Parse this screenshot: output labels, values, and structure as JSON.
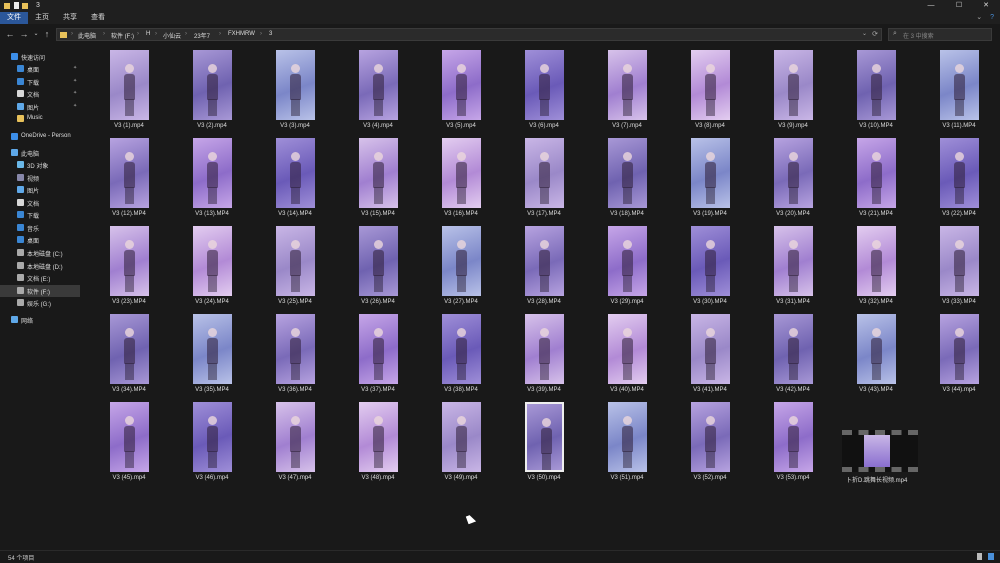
{
  "window": {
    "title": "3",
    "controls": {
      "minimize": "—",
      "maximize": "☐",
      "close": "✕"
    }
  },
  "ribbon": {
    "tabs": [
      "文件",
      "主页",
      "共享",
      "查看"
    ],
    "active_tab": 0,
    "expand_glyph": "⌄",
    "help_glyph": "?"
  },
  "nav": {
    "back": "←",
    "forward": "→",
    "recent": "⌄",
    "up": "↑",
    "dropdown": "⌄",
    "refresh": "⟳"
  },
  "breadcrumb": [
    "此电脑",
    "软件 (F:)",
    "H",
    "小仙云",
    "23年7",
    "FXHMRW",
    "3"
  ],
  "breadcrumb_sep": "›",
  "search": {
    "placeholder": "在 3 中搜索",
    "icon": "search-icon"
  },
  "sidebar": {
    "items": [
      {
        "label": "快速访问",
        "icon": "star-icon",
        "color": "#3c8ee8",
        "indent": 0,
        "pinned": false
      },
      {
        "label": "桌面",
        "icon": "desktop-icon",
        "color": "#3a86d4",
        "indent": 1,
        "pinned": true
      },
      {
        "label": "下载",
        "icon": "download-icon",
        "color": "#3a86d4",
        "indent": 1,
        "pinned": true
      },
      {
        "label": "文档",
        "icon": "documents-icon",
        "color": "#d8d8d8",
        "indent": 1,
        "pinned": true
      },
      {
        "label": "图片",
        "icon": "pictures-icon",
        "color": "#5fa8e8",
        "indent": 1,
        "pinned": true
      },
      {
        "label": "Music",
        "icon": "folder-icon",
        "color": "#e8c15a",
        "indent": 1,
        "pinned": false
      },
      {
        "label": "OneDrive - Person",
        "icon": "onedrive-icon",
        "color": "#3c8ee8",
        "indent": 0,
        "pinned": false
      },
      {
        "label": "此电脑",
        "icon": "this-pc-icon",
        "color": "#5fa8e8",
        "indent": 0,
        "pinned": false
      },
      {
        "label": "3D 对象",
        "icon": "3d-objects-icon",
        "color": "#6ab8e8",
        "indent": 1,
        "pinned": false
      },
      {
        "label": "视频",
        "icon": "videos-icon",
        "color": "#8888aa",
        "indent": 1,
        "pinned": false
      },
      {
        "label": "图片",
        "icon": "pictures-icon",
        "color": "#5fa8e8",
        "indent": 1,
        "pinned": false
      },
      {
        "label": "文档",
        "icon": "documents-icon",
        "color": "#d8d8d8",
        "indent": 1,
        "pinned": false
      },
      {
        "label": "下载",
        "icon": "download-icon",
        "color": "#3a86d4",
        "indent": 1,
        "pinned": false
      },
      {
        "label": "音乐",
        "icon": "music-icon",
        "color": "#3a86d4",
        "indent": 1,
        "pinned": false
      },
      {
        "label": "桌面",
        "icon": "desktop-icon",
        "color": "#3a86d4",
        "indent": 1,
        "pinned": false
      },
      {
        "label": "本地磁盘 (C:)",
        "icon": "drive-icon",
        "color": "#aaaaaa",
        "indent": 1,
        "pinned": false
      },
      {
        "label": "本地磁盘 (D:)",
        "icon": "drive-icon",
        "color": "#aaaaaa",
        "indent": 1,
        "pinned": false
      },
      {
        "label": "文档 (E:)",
        "icon": "drive-icon",
        "color": "#aaaaaa",
        "indent": 1,
        "pinned": false
      },
      {
        "label": "软件 (F:)",
        "icon": "drive-icon",
        "color": "#aaaaaa",
        "indent": 1,
        "pinned": false,
        "selected": true
      },
      {
        "label": "娱乐 (G:)",
        "icon": "drive-icon",
        "color": "#aaaaaa",
        "indent": 1,
        "pinned": false
      },
      {
        "label": "网络",
        "icon": "network-icon",
        "color": "#5fa8e8",
        "indent": 0,
        "pinned": false
      }
    ],
    "pin_glyph": "📌"
  },
  "files": [
    "V3 (1).mp4",
    "V3 (2).mp4",
    "V3 (3).mp4",
    "V3 (4).mp4",
    "V3 (5).mp4",
    "V3 (6).mp4",
    "V3 (7).mp4",
    "V3 (8).mp4",
    "V3 (9).mp4",
    "V3 (10).MP4",
    "V3 (11).MP4",
    "V3 (12).MP4",
    "V3 (13).MP4",
    "V3 (14).MP4",
    "V3 (15).MP4",
    "V3 (16).MP4",
    "V3 (17).MP4",
    "V3 (18).MP4",
    "V3 (19).MP4",
    "V3 (20).MP4",
    "V3 (21).MP4",
    "V3 (22).MP4",
    "V3 (23).MP4",
    "V3 (24).MP4",
    "V3 (25).MP4",
    "V3 (26).MP4",
    "V3 (27).MP4",
    "V3 (28).MP4",
    "V3 (29).mp4",
    "V3 (30).MP4",
    "V3 (31).MP4",
    "V3 (32).MP4",
    "V3 (33).MP4",
    "V3 (34).MP4",
    "V3 (35).MP4",
    "V3 (36).MP4",
    "V3 (37).MP4",
    "V3 (38).MP4",
    "V3 (39).MP4",
    "V3 (40).MP4",
    "V3 (41).MP4",
    "V3 (42).MP4",
    "V3 (43).MP4",
    "V3 (44).mp4",
    "V3 (45).mp4",
    "V3 (46).mp4",
    "V3 (47).mp4",
    "V3 (48).mp4",
    "V3 (49).mp4",
    "V3 (50).mp4",
    "V3 (51).mp4",
    "V3 (52).mp4",
    "V3 (53).mp4",
    "卜折D.跳舞长视频.mp4"
  ],
  "status": {
    "item_count": "54 个项目"
  },
  "colors": {
    "accent": "#2b579a",
    "background": "#191919",
    "thumb_purple": "#8a6fd0",
    "thumb_pink": "#c9a3d8"
  }
}
